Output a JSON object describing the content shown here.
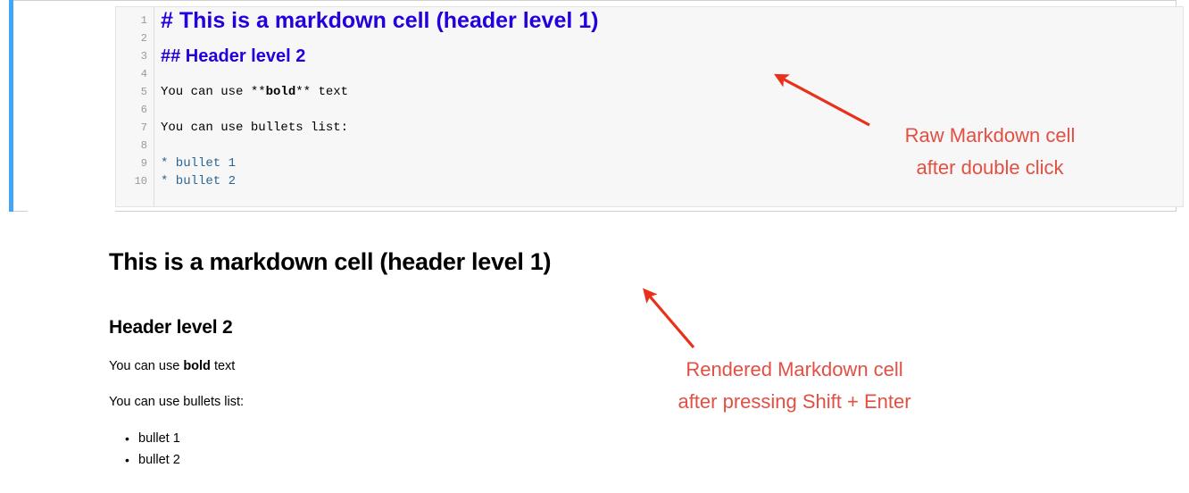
{
  "notebook": {
    "cell": {
      "type": "markdown",
      "state": "edit-mode",
      "selected_bar_color": "#42a5f5",
      "editor_bg": "#f7f7f7",
      "line_numbers": [
        "1",
        "2",
        "3",
        "4",
        "5",
        "6",
        "7",
        "8",
        "9",
        "10"
      ],
      "source_lines": [
        {
          "n": "1",
          "text": "# This is a markdown cell (header level 1)",
          "style": "h1-header"
        },
        {
          "n": "2",
          "text": "",
          "style": "plain"
        },
        {
          "n": "3",
          "text": "## Header level 2",
          "style": "h2-header"
        },
        {
          "n": "4",
          "text": "",
          "style": "plain"
        },
        {
          "n": "5",
          "text": "You can use **bold** text",
          "style": "plain-bold-marked"
        },
        {
          "n": "6",
          "text": "",
          "style": "plain"
        },
        {
          "n": "7",
          "text": "You can use bullets list:",
          "style": "plain"
        },
        {
          "n": "8",
          "text": "",
          "style": "plain"
        },
        {
          "n": "9",
          "text": "* bullet 1",
          "style": "bullet"
        },
        {
          "n": "10",
          "text": "* bullet 2",
          "style": "bullet"
        }
      ],
      "line5_pre": "You can use **",
      "line5_bold": "bold",
      "line5_post": "** text",
      "header_color": "#2200dd",
      "bullet_color": "#2b6693"
    }
  },
  "rendered": {
    "h1": "This is a markdown cell (header level 1)",
    "h2": "Header level 2",
    "paragraph1_pre": "You can use ",
    "paragraph1_bold": "bold",
    "paragraph1_post": " text",
    "paragraph2": "You can use bullets list:",
    "bullets": [
      "bullet 1",
      "bullet 2"
    ]
  },
  "annotations": {
    "color": "#e34f43",
    "raw": {
      "line1": "Raw Markdown cell",
      "line2": "after double click"
    },
    "rendered": {
      "line1": "Rendered Markdown cell",
      "line2": "after pressing Shift + Enter"
    }
  }
}
